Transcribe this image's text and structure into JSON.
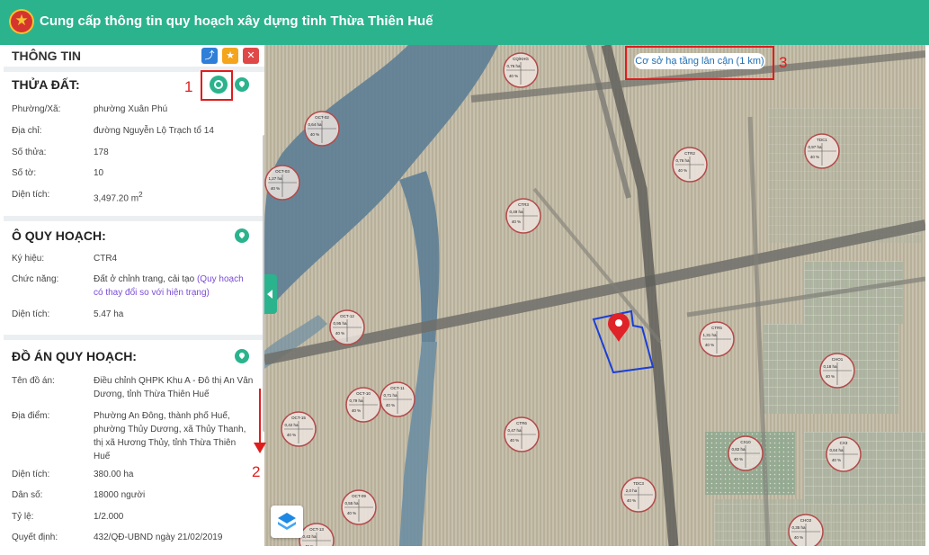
{
  "header": {
    "title": "Cung cấp thông tin quy hoạch xây dựng tỉnh Thừa Thiên Huế"
  },
  "panel": {
    "title": "THÔNG TIN",
    "parcel": {
      "title": "THỬA ĐẤT:",
      "rows": [
        {
          "label": "Phường/Xã:",
          "value": "phường Xuân Phú"
        },
        {
          "label": "Địa chỉ:",
          "value": "đường Nguyễn Lộ Trạch tổ 14"
        },
        {
          "label": "Số thửa:",
          "value": "178"
        },
        {
          "label": "Số tờ:",
          "value": "10"
        },
        {
          "label": "Diện tích:",
          "value": "3,497.20 m",
          "sup": "2"
        }
      ]
    },
    "zone": {
      "title": "Ô QUY HOẠCH:",
      "rows": [
        {
          "label": "Ký hiệu:",
          "value": "CTR4"
        },
        {
          "label": "Chức năng:",
          "value": "Đất ở chỉnh trang, cải tạo",
          "link": "(Quy hoạch có thay đổi so với hiện trạng)"
        },
        {
          "label": "Diện tích:",
          "value": "5.47 ha"
        }
      ]
    },
    "plan": {
      "title": "ĐỒ ÁN QUY HOẠCH:",
      "rows": [
        {
          "label": "Tên đồ án:",
          "value": "Điều chỉnh QHPK Khu A - Đô thị An Vân Dương, tỉnh Thừa Thiên Huế"
        },
        {
          "label": "Địa điểm:",
          "value": "Phường An Đông, thành phố Huế, phường Thủy Dương, xã Thủy Thanh, thị xã Hương Thủy, tỉnh Thừa Thiên Huế"
        },
        {
          "label": "Diện tích:",
          "value": "380.00 ha"
        },
        {
          "label": "Dân số:",
          "value": "18000 người"
        },
        {
          "label": "Tỷ lệ:",
          "value": "1/2.000"
        },
        {
          "label": "Quyết định:",
          "value": "432/QĐ-UBND ngày 21/02/2019"
        }
      ]
    }
  },
  "map": {
    "nearby_label": "Cơ sở hạ tầng lân cận (1 km)",
    "zones": [
      {
        "code": "CQ/KHG",
        "area": "0,76 ha",
        "pct": "40 %"
      },
      {
        "code": "OCT-02",
        "area": "0,64 ha",
        "pct": "40 %"
      },
      {
        "code": "OCT-03",
        "area": "1,27 ha",
        "pct": "40 %"
      },
      {
        "code": "CTR2",
        "area": "0,76 ha",
        "pct": "40 %"
      },
      {
        "code": "CTR3",
        "area": "0,49 ha",
        "pct": "40 %"
      },
      {
        "code": "TDC1",
        "area": "0,97 ha",
        "pct": "40 %"
      },
      {
        "code": "OCT-12",
        "area": "0,95 ha",
        "pct": "40 %"
      },
      {
        "code": "CTR5",
        "area": "1,31 ha",
        "pct": "40 %"
      },
      {
        "code": "CHO1",
        "area": "0,18 ha",
        "pct": "40 %"
      },
      {
        "code": "OCT-10",
        "area": "0,79 ha",
        "pct": "40 %"
      },
      {
        "code": "OCT-11",
        "area": "0,71 ha",
        "pct": "40 %"
      },
      {
        "code": "OCT-15",
        "area": "0,42 ha",
        "pct": "40 %"
      },
      {
        "code": "CTR6",
        "area": "0,47 ha",
        "pct": "40 %"
      },
      {
        "code": "CX10",
        "area": "0,82 ha",
        "pct": "40 %"
      },
      {
        "code": "CX3",
        "area": "0,64 ha",
        "pct": "40 %"
      },
      {
        "code": "OCT-09",
        "area": "0,55 ha",
        "pct": "40 %"
      },
      {
        "code": "TDC3",
        "area": "2,0 ha",
        "pct": "40 %"
      },
      {
        "code": "CHO2",
        "area": "0,35 ha",
        "pct": "40 %"
      },
      {
        "code": "OCT-13",
        "area": "0,43 ha",
        "pct": "40 %"
      }
    ]
  },
  "annotations": {
    "one": "1",
    "two": "2",
    "three": "3"
  }
}
